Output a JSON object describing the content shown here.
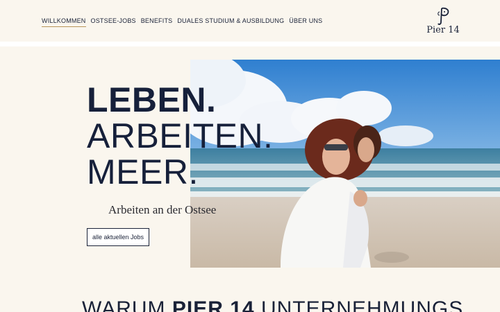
{
  "nav": {
    "items": [
      {
        "label": "WILLKOMMEN",
        "active": true
      },
      {
        "label": "OSTSEE-JOBS"
      },
      {
        "label": "BENEFITS"
      },
      {
        "label": "DUALES STUDIUM & AUSBILDUNG"
      },
      {
        "label": "ÜBER UNS"
      }
    ]
  },
  "logo": {
    "text": "Pier 14",
    "icon": "pier14-monogram-icon"
  },
  "hero": {
    "headline": [
      "LEBEN.",
      "ARBEITEN.",
      "MEER."
    ],
    "subline": "Arbeiten an der Ostsee",
    "cta_label": "alle aktuellen Jobs",
    "photo_alt": "beach-photo"
  },
  "section": {
    "title_pre": "WARUM ",
    "title_bold": "PIER 14",
    "title_post": " UNTERNEHMUNGS"
  },
  "colors": {
    "accent": "#b8955a",
    "navy": "#1a2238",
    "background": "#faf6ee"
  }
}
